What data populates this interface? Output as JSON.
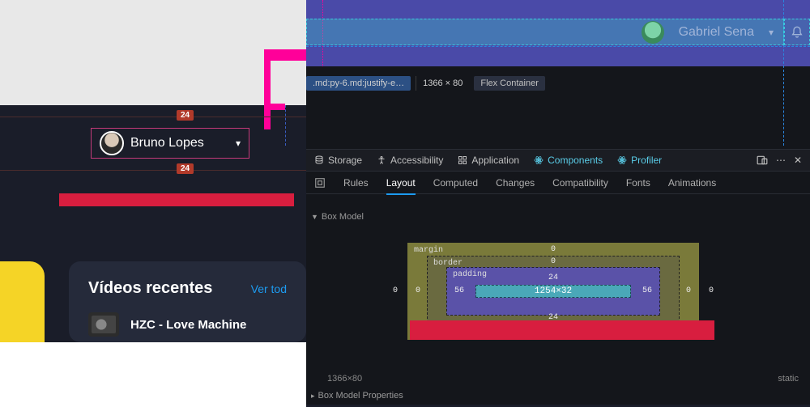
{
  "left": {
    "margin_value": "24",
    "user": {
      "name": "Bruno Lopes"
    },
    "card": {
      "title": "Vídeos recentes",
      "link": "Ver tod",
      "video_title": "HZC - Love Machine"
    }
  },
  "header_right": {
    "name": "Gabriel Sena"
  },
  "element_info": {
    "class_fragment": ".md:py-6.md:justify-e…",
    "dimensions": "1366 × 80",
    "flex_label": "Flex Container"
  },
  "devtools_tabs": {
    "storage": "Storage",
    "accessibility": "Accessibility",
    "application": "Application",
    "components": "Components",
    "profiler": "Profiler"
  },
  "subtabs": {
    "rules": "Rules",
    "layout": "Layout",
    "computed": "Computed",
    "changes": "Changes",
    "compatibility": "Compatibility",
    "fonts": "Fonts",
    "animations": "Animations"
  },
  "boxmodel": {
    "header": "Box Model",
    "margin_label": "margin",
    "border_label": "border",
    "padding_label": "padding",
    "margin": {
      "top": "0",
      "left": "0",
      "right": "0"
    },
    "border": {
      "top": "0",
      "left": "0",
      "right": "0"
    },
    "padding": {
      "top": "24",
      "left": "56",
      "right": "56",
      "bottom": "24"
    },
    "content": "1254×32",
    "properties_header": "Box Model Properties"
  },
  "footer": {
    "dims": "1366×80",
    "position": "static"
  }
}
